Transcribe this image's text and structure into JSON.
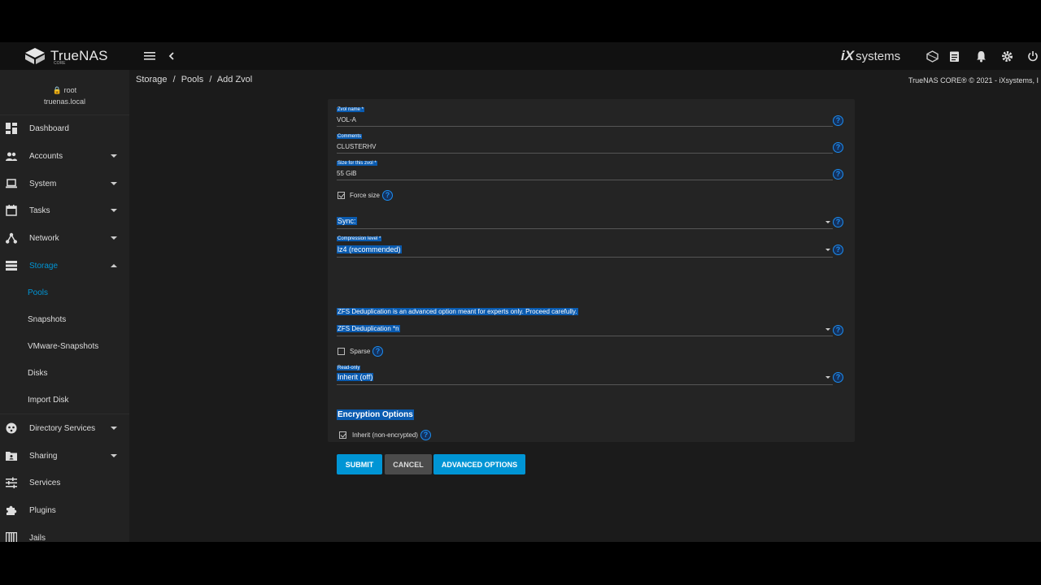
{
  "topbar": {
    "brand": "TrueNAS",
    "brand_sub": "CORE",
    "vendor": "systems",
    "vendor_mark": "iX"
  },
  "user": {
    "name": "root",
    "host": "truenas.local"
  },
  "sidebar": {
    "items": [
      {
        "label": "Dashboard",
        "icon": "dashboard-icon"
      },
      {
        "label": "Accounts",
        "icon": "accounts-icon"
      },
      {
        "label": "System",
        "icon": "laptop-icon"
      },
      {
        "label": "Tasks",
        "icon": "calendar-icon"
      },
      {
        "label": "Network",
        "icon": "network-icon"
      },
      {
        "label": "Storage",
        "icon": "storage-icon"
      },
      {
        "label": "Directory Services",
        "icon": "directory-icon"
      },
      {
        "label": "Sharing",
        "icon": "sharing-icon"
      },
      {
        "label": "Services",
        "icon": "tune-icon"
      },
      {
        "label": "Plugins",
        "icon": "puzzle-icon"
      },
      {
        "label": "Jails",
        "icon": "jail-icon"
      }
    ],
    "storage_sub": [
      "Pools",
      "Snapshots",
      "VMware-Snapshots",
      "Disks",
      "Import Disk"
    ]
  },
  "breadcrumb": {
    "a": "Storage",
    "b": "Pools",
    "c": "Add Zvol",
    "sep": "/"
  },
  "copyright": "TrueNAS CORE® © 2021 - iXsystems, I",
  "form": {
    "zvol_name_label": "Zvol name *",
    "zvol_name_value": "VOL-A",
    "comments_label": "Comments",
    "comments_value": "CLUSTERHV",
    "size_label": "Size for this zvol *",
    "size_value": "55 GiB",
    "force_size": "Force size",
    "sync": "Sync:",
    "compression_label": "Compression level *",
    "compression_value": "lz4 (recommended)",
    "dedup_note": "ZFS Deduplication is an advanced option meant for experts only. Proceed carefully.",
    "dedup": "ZFS Deduplication *n",
    "sparse": "Sparse",
    "readonly_label": "Read-only",
    "readonly_value": "Inherit (off)",
    "encryption_title": "Encryption Options",
    "inherit": "Inherit (non-encrypted)",
    "help_glyph": "?"
  },
  "buttons": {
    "submit": "SUBMIT",
    "cancel": "CANCEL",
    "advanced": "ADVANCED OPTIONS"
  },
  "colors": {
    "accent": "#0095d5",
    "selection": "#0a5bb0",
    "help": "#1c8df0"
  }
}
